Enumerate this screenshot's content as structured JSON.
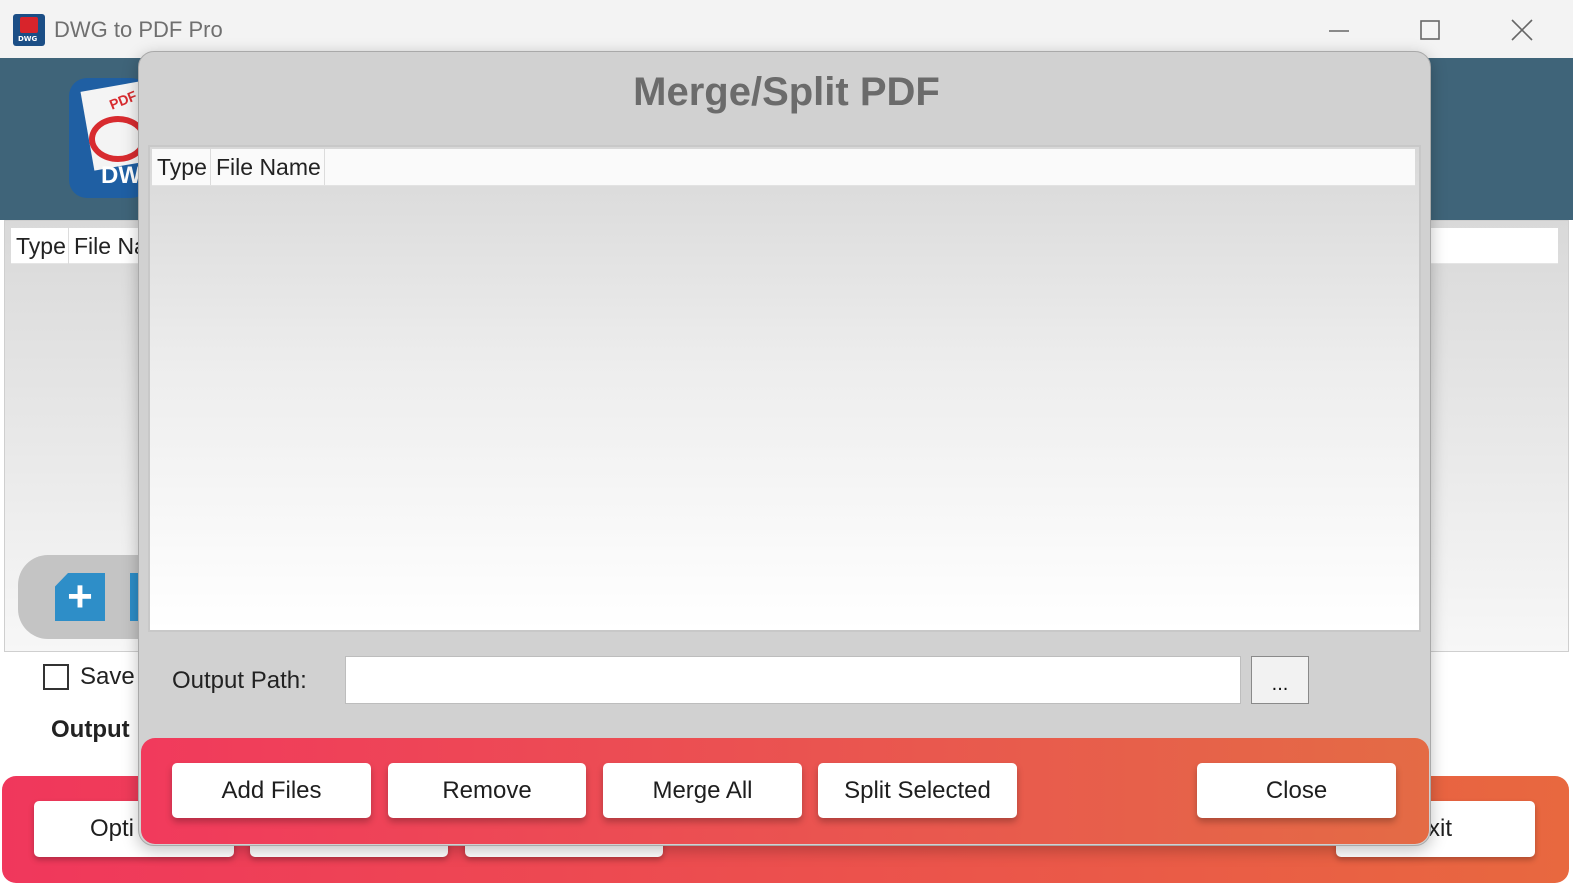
{
  "window": {
    "title": "DWG to PDF Pro",
    "controls": [
      "minimize-icon",
      "maximize-icon",
      "close-icon"
    ]
  },
  "app_logo": {
    "pdf_text": "PDF",
    "dwg_text": "DW"
  },
  "main": {
    "list_columns": [
      "Type",
      "File Na"
    ],
    "save_label": "Save",
    "output_label": "Output",
    "buttons": {
      "options_partial": "Opti",
      "exit_partial": "xit"
    }
  },
  "dialog": {
    "title": "Merge/Split PDF",
    "columns": [
      "Type",
      "File Name"
    ],
    "output_path_label": "Output Path:",
    "output_path_value": "",
    "browse_label": "...",
    "buttons": {
      "add_files": "Add Files",
      "remove": "Remove",
      "merge_all": "Merge All",
      "split_selected": "Split Selected",
      "close": "Close"
    }
  },
  "colors": {
    "header_band": "#3f6479",
    "accent_gradient_start": "#f13a5c",
    "accent_gradient_end": "#e46b45",
    "dialog_bg": "#d1d1d1",
    "title_gray": "#6b6b6b",
    "icon_blue": "#2e8ec8"
  }
}
